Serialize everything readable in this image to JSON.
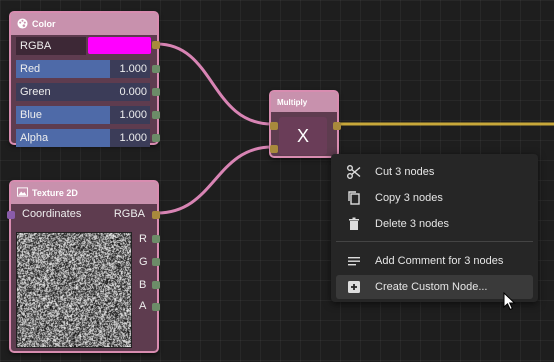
{
  "color_node": {
    "title": "Color",
    "rows": [
      {
        "label": "RGBA",
        "swatch": "#ff00ff"
      },
      {
        "label": "Red",
        "value": "1.000"
      },
      {
        "label": "Green",
        "value": "0.000"
      },
      {
        "label": "Blue",
        "value": "1.000"
      },
      {
        "label": "Alpha",
        "value": "1.000"
      }
    ]
  },
  "texture_node": {
    "title": "Texture 2D",
    "input_label": "Coordinates",
    "output_label": "RGBA",
    "channels": [
      "R",
      "G",
      "B",
      "A"
    ]
  },
  "multiply_node": {
    "title": "Multiply",
    "symbol": "X"
  },
  "context_menu": {
    "items": [
      {
        "label": "Cut 3 nodes",
        "icon": "scissors-icon"
      },
      {
        "label": "Copy 3 nodes",
        "icon": "copy-icon"
      },
      {
        "label": "Delete 3 nodes",
        "icon": "trash-icon"
      },
      {
        "label": "Add Comment for 3 nodes",
        "icon": "comment-icon"
      },
      {
        "label": "Create Custom Node...",
        "icon": "plus-box-icon"
      }
    ]
  },
  "colors": {
    "node_header": "#c891ad",
    "node_border": "#d88cb0",
    "node_body": "#5e3c4f",
    "slider_fill": "#4e6aa8",
    "wire_pink": "#d884b4",
    "wire_yellow": "#c8a83a",
    "canvas": "#1e1e1e",
    "menu_bg": "#262626"
  }
}
